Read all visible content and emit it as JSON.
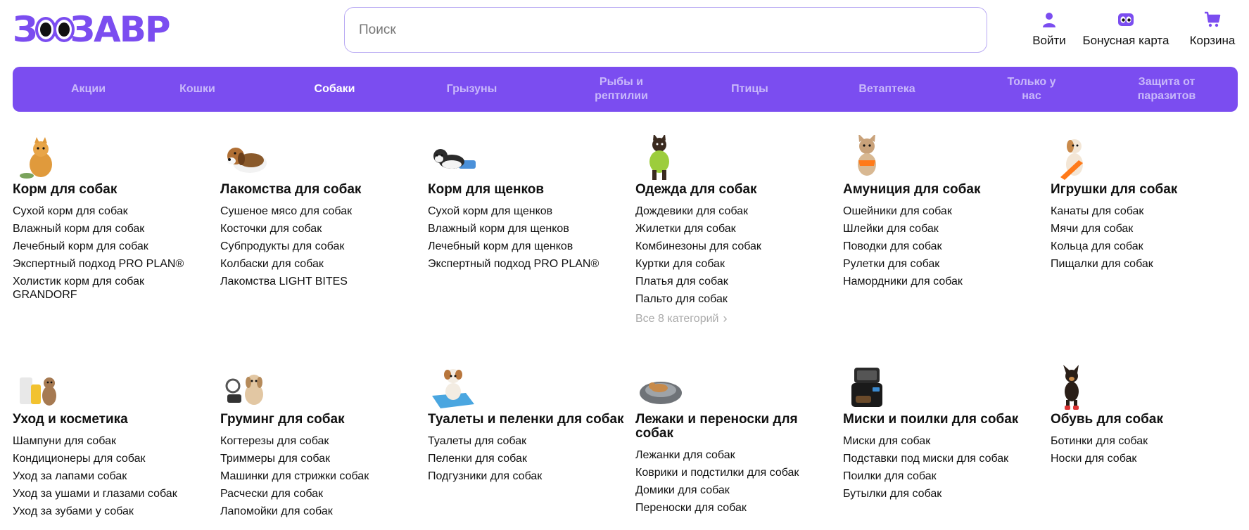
{
  "brand": {
    "logo_part1": "З",
    "logo_part2": "ЗАВР",
    "accent": "#7b4df0"
  },
  "search": {
    "placeholder": "Поиск"
  },
  "header_actions": [
    {
      "label": "Войти",
      "icon": "user-icon"
    },
    {
      "label": "Бонусная карта",
      "icon": "bonus-card-icon"
    },
    {
      "label": "Корзина",
      "icon": "cart-icon"
    }
  ],
  "nav": {
    "items": [
      {
        "label": "Акции"
      },
      {
        "label": "Кошки"
      },
      {
        "label": "Собаки",
        "active": true
      },
      {
        "label": "Грызуны"
      },
      {
        "label": "Рыбы и рептилии"
      },
      {
        "label": "Птицы"
      },
      {
        "label": "Ветаптека"
      },
      {
        "label": "Только у нас"
      },
      {
        "label": "Защита от паразитов"
      }
    ]
  },
  "categories": [
    {
      "title": "Корм для собак",
      "image": "pomeranian-dog-image",
      "links": [
        "Сухой корм для собак",
        "Влажный корм для собак",
        "Лечебный корм для собак",
        "Экспертный подход PRO PLAN®",
        "Холистик корм для собак GRANDORF"
      ]
    },
    {
      "title": "Лакомства для собак",
      "image": "beagle-dog-image",
      "links": [
        "Сушеное мясо для собак",
        "Косточки для собак",
        "Субпродукты для собак",
        "Колбаски для собак",
        "Лакомства LIGHT BITES"
      ]
    },
    {
      "title": "Корм для щенков",
      "image": "husky-puppy-image",
      "links": [
        "Сухой корм для щенков",
        "Влажный корм для щенков",
        "Лечебный корм для щенков",
        "Экспертный подход PRO PLAN®"
      ]
    },
    {
      "title": "Одежда для собак",
      "image": "dog-in-clothes-image",
      "links": [
        "Дождевики для собак",
        "Жилетки для собак",
        "Комбинезоны для собак",
        "Куртки для собак",
        "Платья для собак",
        "Пальто для собак"
      ],
      "more": "Все 8 категорий"
    },
    {
      "title": "Амуниция для собак",
      "image": "french-bulldog-harness-image",
      "links": [
        "Ошейники для собак",
        "Шлейки для собак",
        "Поводки для собак",
        "Рулетки для собак",
        "Намордники для собак"
      ]
    },
    {
      "title": "Игрушки для собак",
      "image": "dog-with-toy-image",
      "links": [
        "Канаты для собак",
        "Мячи для собак",
        "Кольца для собак",
        "Пищалки для собак"
      ]
    },
    {
      "title": "Уход и косметика",
      "image": "dog-cosmetics-image",
      "links": [
        "Шампуни для собак",
        "Кондиционеры для собак",
        "Уход за лапами собак",
        "Уход за ушами и глазами собак",
        "Уход за зубами у собак"
      ]
    },
    {
      "title": "Груминг для собак",
      "image": "grooming-tools-image",
      "links": [
        "Когтерезы для собак",
        "Триммеры для собак",
        "Машинки для стрижки собак",
        "Расчески для собак",
        "Лапомойки для собак"
      ]
    },
    {
      "title": "Туалеты и пеленки для собак",
      "image": "dog-toilet-image",
      "links": [
        "Туалеты для собак",
        "Пеленки для собак",
        "Подгузники для собак"
      ]
    },
    {
      "title": "Лежаки и переноски для собак",
      "image": "dog-bed-image",
      "links": [
        "Лежанки для собак",
        "Коврики и подстилки для собак",
        "Домики для собак",
        "Переноски для собак"
      ]
    },
    {
      "title": "Миски и поилки для собак",
      "image": "auto-feeder-image",
      "links": [
        "Миски для собак",
        "Подставки под миски для собак",
        "Поилки для собак",
        "Бутылки для собак"
      ]
    },
    {
      "title": "Обувь для собак",
      "image": "small-dog-shoes-image",
      "links": [
        "Ботинки для собак",
        "Носки для собак"
      ]
    }
  ]
}
